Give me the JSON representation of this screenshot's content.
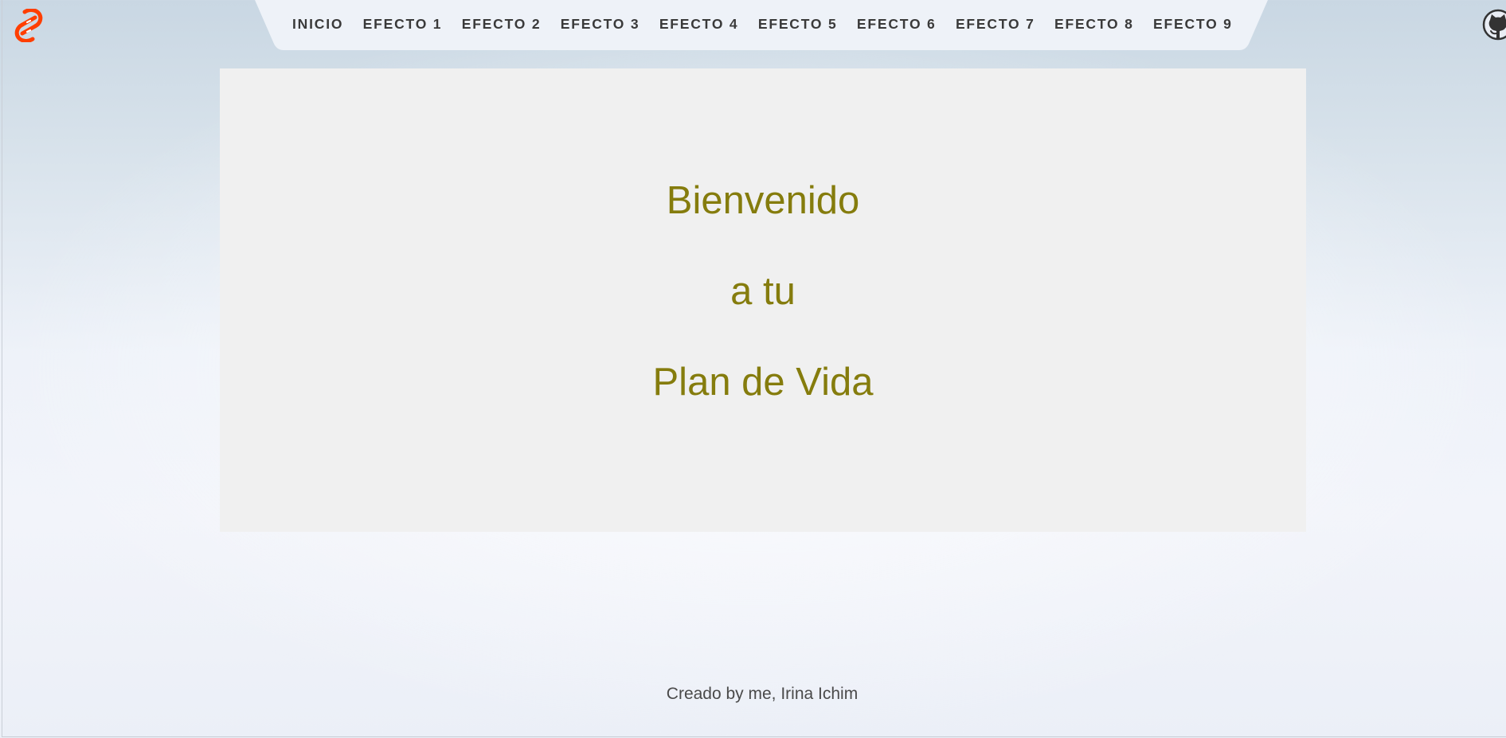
{
  "header": {
    "logo_icon": "svelte-logo-icon",
    "github_icon": "github-icon",
    "nav": [
      {
        "label": "INICIO"
      },
      {
        "label": "EFECTO 1"
      },
      {
        "label": "EFECTO 2"
      },
      {
        "label": "EFECTO 3"
      },
      {
        "label": "EFECTO 4"
      },
      {
        "label": "EFECTO 5"
      },
      {
        "label": "EFECTO 6"
      },
      {
        "label": "EFECTO 7"
      },
      {
        "label": "EFECTO 8"
      },
      {
        "label": "EFECTO 9"
      }
    ]
  },
  "hero": {
    "line1": "Bienvenido",
    "line2": "a tu",
    "line3": "Plan de Vida"
  },
  "footer": {
    "text": "Creado by me, Irina Ichim"
  },
  "colors": {
    "accent_text": "#857c0d",
    "svelte_brand": "#ff3e00",
    "nav_text": "#3a3a3a",
    "hero_bg": "#f0f0f0"
  }
}
